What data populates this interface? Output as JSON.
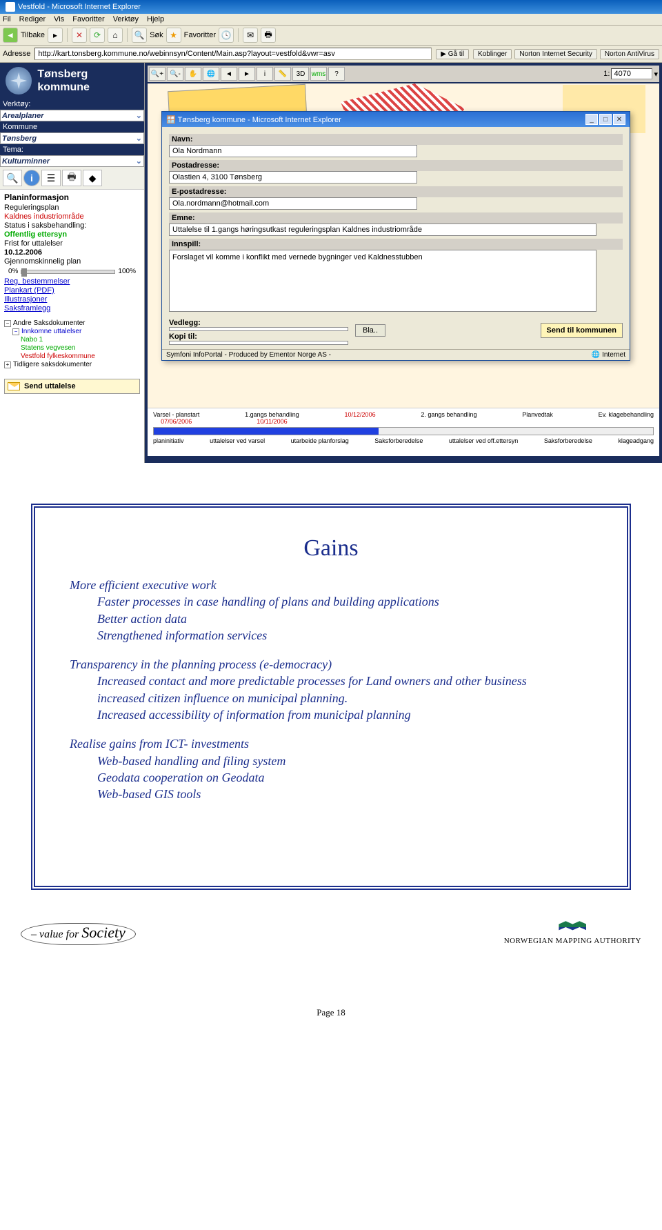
{
  "browser": {
    "title": "Vestfold - Microsoft Internet Explorer",
    "menu": [
      "Fil",
      "Rediger",
      "Vis",
      "Favoritter",
      "Verktøy",
      "Hjelp"
    ],
    "back_label": "Tilbake",
    "search_label": "Søk",
    "fav_label": "Favoritter",
    "address_label": "Adresse",
    "address_url": "http://kart.tonsberg.kommune.no/webinnsyn/Content/Main.asp?layout=vestfold&vwr=asv",
    "go_label": "Gå til",
    "right_buttons": [
      "Koblinger",
      "Norton Internet Security",
      "Norton AntiVirus"
    ]
  },
  "scale": {
    "prefix": "1:",
    "value": "4070"
  },
  "sidebar": {
    "kommune_name": "Tønsberg kommune",
    "verktoy_label": "Verktøy:",
    "verktoy_value": "Arealplaner",
    "kommune_label": "Kommune",
    "kommune_value": "Tønsberg",
    "tema_label": "Tema:",
    "tema_value": "Kulturminner",
    "plan": {
      "title": "Planinformasjon",
      "line1": "Reguleringsplan",
      "line2": "Kaldnes industriområde",
      "line3": "Status i saksbehandling:",
      "line4": "Offentlig ettersyn",
      "line5": "Frist for uttalelser",
      "line6": "10.12.2006",
      "line7": "Gjennomskinnelig plan",
      "pct0": "0%",
      "pct100": "100%",
      "link1": "Reg. bestemmelser",
      "link2": "Plankart (PDF)",
      "link3": "Illustrasjoner",
      "link4": "Saksframlegg"
    },
    "tree": {
      "andre": "Andre Saksdokumenter",
      "innkomne": "Innkomne uttalelser",
      "nabo": "Nabo 1",
      "statens": "Statens vegvesen",
      "vestfold": "Vestfold fylkeskommune",
      "tidligere": "Tidligere saksdokumenter"
    },
    "send_uttalelse": "Send uttalelse"
  },
  "popup": {
    "title": "Tønsberg kommune - Microsoft Internet Explorer",
    "navn_label": "Navn:",
    "navn_value": "Ola Nordmann",
    "post_label": "Postadresse:",
    "post_value": "Olastien 4, 3100 Tønsberg",
    "epost_label": "E-postadresse:",
    "epost_value": "Ola.nordmann@hotmail.com",
    "emne_label": "Emne:",
    "emne_value": "Uttalelse til 1.gangs høringsutkast reguleringsplan Kaldnes industriområde",
    "innspill_label": "Innspill:",
    "innspill_value": "Forslaget vil komme i konflikt med vernede bygninger ved Kaldnesstubben",
    "vedlegg_label": "Vedlegg:",
    "kopi_label": "Kopi til:",
    "bla_btn": "Bla..",
    "send_btn": "Send til kommunen",
    "status_left": "Symfoni InfoPortal        -        Produced by Ementor Norge AS        -",
    "status_right": "Internet"
  },
  "timeline": {
    "varsel": "Varsel - planstart",
    "varsel_date": "07/06/2006",
    "gang1": "1.gangs behandling",
    "gang1_date": "10/11/2006",
    "date3": "10/12/2006",
    "gang2": "2. gangs behandling",
    "planvedtak": "Planvedtak",
    "klage": "Ev. klagebehandling",
    "b1": "planinitiativ",
    "b2": "uttalelser ved varsel",
    "b3": "utarbeide planforslag",
    "b4": "Saksforberedelse",
    "b5": "uttalelser ved off.ettersyn",
    "b6": "Saksforberedelse",
    "b7": "klageadgang"
  },
  "slide2": {
    "title": "Gains",
    "p1": "More efficient executive work",
    "p1a": "Faster processes in case handling of plans and building applications",
    "p1b": "Better action data",
    "p1c": "Strengthened information services",
    "p2": "Transparency in the planning process (e-democracy)",
    "p2a": "Increased contact and more predictable processes for Land owners  and other business",
    "p2b": "increased citizen influence on municipal planning.",
    "p2c": "Increased accessibility of information from municipal planning",
    "p3": "Realise gains from ICT- investments",
    "p3a": "Web-based handling and filing system",
    "p3b": "Geodata cooperation on Geodata",
    "p3c": "Web-based GIS tools",
    "vfs_pre": "– value for",
    "vfs_word": "Society",
    "nma": "NORWEGIAN MAPPING AUTHORITY"
  },
  "page_number": "Page 18"
}
